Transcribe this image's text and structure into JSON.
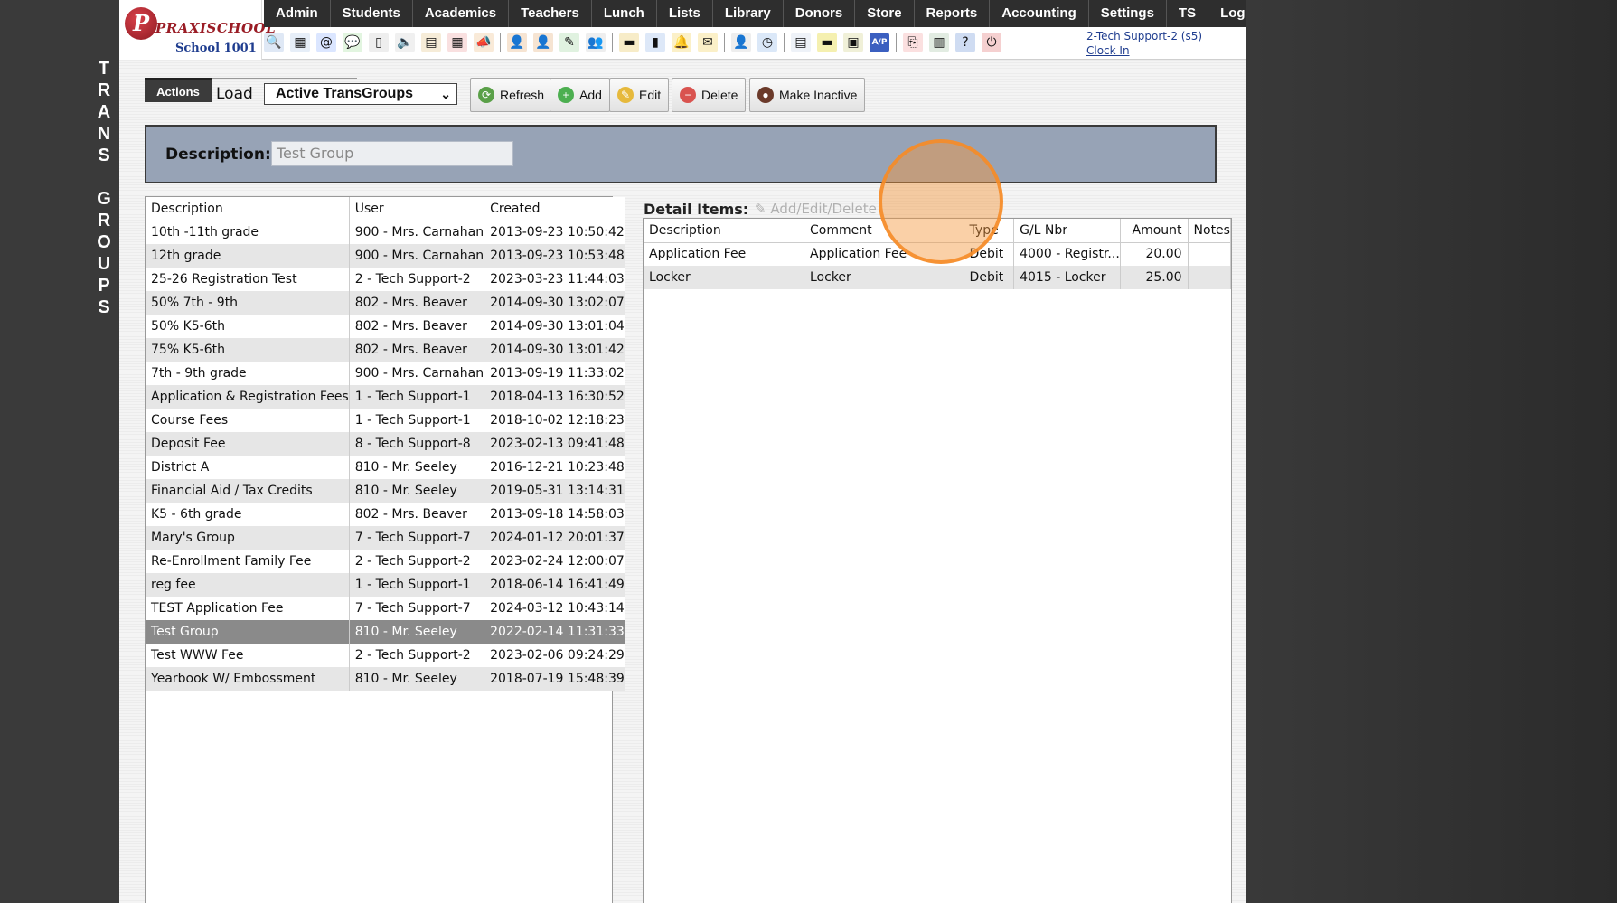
{
  "vertical_title": [
    "T",
    "R",
    "A",
    "N",
    "S",
    "",
    "G",
    "R",
    "O",
    "U",
    "P",
    "S"
  ],
  "logo": {
    "badge": "P",
    "brand": "PRAXISCHOOL",
    "school": "School 1001"
  },
  "menu": [
    "Admin",
    "Students",
    "Academics",
    "Teachers",
    "Lunch",
    "Lists",
    "Library",
    "Donors",
    "Store",
    "Reports",
    "Accounting",
    "Settings",
    "TS",
    "Logout"
  ],
  "toolbar_icons": [
    {
      "name": "search-icon",
      "glyph": "🔍",
      "color": "#dfe8f5"
    },
    {
      "name": "grid-icon",
      "glyph": "▦",
      "color": "#e6eef8"
    },
    {
      "name": "email-icon",
      "glyph": "@",
      "color": "#dbe6ff"
    },
    {
      "name": "chat-icon",
      "glyph": "💬",
      "color": "#e2f5e0"
    },
    {
      "name": "phone-icon",
      "glyph": "▯",
      "color": "#eeeeee"
    },
    {
      "name": "speaker-icon",
      "glyph": "🔈",
      "color": "#f0f0f0"
    },
    {
      "name": "report-icon",
      "glyph": "▤",
      "color": "#f6ecd8"
    },
    {
      "name": "calendar-icon",
      "glyph": "▦",
      "color": "#f9e0e0"
    },
    {
      "name": "megaphone-icon",
      "glyph": "📣",
      "color": "#f9ead8"
    },
    {
      "name": "user-icon",
      "glyph": "👤",
      "color": "#f6e4d2"
    },
    {
      "name": "teacher-icon",
      "glyph": "👤",
      "color": "#f6e4d2"
    },
    {
      "name": "eraser-icon",
      "glyph": "✎",
      "color": "#e0f2e0"
    },
    {
      "name": "group-icon",
      "glyph": "👥",
      "color": "#eeeeee"
    },
    {
      "name": "card-icon",
      "glyph": "▬",
      "color": "#f7ecc8"
    },
    {
      "name": "book-icon",
      "glyph": "▮",
      "color": "#dde8f8"
    },
    {
      "name": "bell-icon",
      "glyph": "🔔",
      "color": "#fbf0c8"
    },
    {
      "name": "mail-out-icon",
      "glyph": "✉",
      "color": "#fbf0c8"
    },
    {
      "name": "staff-icon",
      "glyph": "👤",
      "color": "#eeeeee"
    },
    {
      "name": "clock-icon",
      "glyph": "◷",
      "color": "#dbe8f8"
    },
    {
      "name": "document-icon",
      "glyph": "▤",
      "color": "#eef2f8"
    },
    {
      "name": "payment-card-icon",
      "glyph": "▬",
      "color": "#f5f0b0"
    },
    {
      "name": "register-icon",
      "glyph": "▣",
      "color": "#f0f0d8"
    },
    {
      "name": "ap-icon",
      "glyph": "A/P",
      "color": "#3b5fc0"
    },
    {
      "name": "pdf-icon",
      "glyph": "⎘",
      "color": "#fbe0e0"
    },
    {
      "name": "money-icon",
      "glyph": "▥",
      "color": "#e2ece2"
    },
    {
      "name": "help-icon",
      "glyph": "?",
      "color": "#cfdcf2"
    },
    {
      "name": "power-icon",
      "glyph": "⏻",
      "color": "#f5d0d0"
    }
  ],
  "user": {
    "name": "2-Tech Support-2 (s5)",
    "clock_in": "Clock In"
  },
  "actions": {
    "tab": "Actions",
    "load_label": "Load",
    "load_value": "Active TransGroups",
    "buttons": {
      "refresh": "Refresh",
      "add": "Add",
      "edit": "Edit",
      "delete": "Delete",
      "make_inactive": "Make Inactive"
    }
  },
  "description": {
    "label": "Description:",
    "value": "Test Group"
  },
  "list": {
    "columns": [
      "Description",
      "User",
      "Created"
    ],
    "rows": [
      [
        "10th -11th grade",
        "900 - Mrs. Carnahan",
        "2013-09-23 10:50:42"
      ],
      [
        "12th grade",
        "900 - Mrs. Carnahan",
        "2013-09-23 10:53:48"
      ],
      [
        "25-26 Registration Test",
        "2 - Tech Support-2",
        "2023-03-23 11:44:03"
      ],
      [
        "50% 7th - 9th",
        "802 - Mrs. Beaver",
        "2014-09-30 13:02:07"
      ],
      [
        "50% K5-6th",
        "802 - Mrs. Beaver",
        "2014-09-30 13:01:04"
      ],
      [
        "75% K5-6th",
        "802 - Mrs. Beaver",
        "2014-09-30 13:01:42"
      ],
      [
        "7th - 9th grade",
        "900 - Mrs. Carnahan",
        "2013-09-19 11:33:02"
      ],
      [
        "Application & Registration Fees",
        "1 - Tech Support-1",
        "2018-04-13 16:30:52"
      ],
      [
        "Course Fees",
        "1 - Tech Support-1",
        "2018-10-02 12:18:23"
      ],
      [
        "Deposit Fee",
        "8 - Tech Support-8",
        "2023-02-13 09:41:48"
      ],
      [
        "District A",
        "810 - Mr. Seeley",
        "2016-12-21 10:23:48"
      ],
      [
        "Financial Aid / Tax Credits",
        "810 - Mr. Seeley",
        "2019-05-31 13:14:31"
      ],
      [
        "K5 - 6th grade",
        "802 - Mrs. Beaver",
        "2013-09-18 14:58:03"
      ],
      [
        "Mary's Group",
        "7 - Tech Support-7",
        "2024-01-12 20:01:37"
      ],
      [
        "Re-Enrollment Family Fee",
        "2 - Tech Support-2",
        "2023-02-24 12:00:07"
      ],
      [
        "reg fee",
        "1 - Tech Support-1",
        "2018-06-14 16:41:49"
      ],
      [
        "TEST Application Fee",
        "7 - Tech Support-7",
        "2024-03-12 10:43:14"
      ],
      [
        "Test Group",
        "810 - Mr. Seeley",
        "2022-02-14 11:31:33"
      ],
      [
        "Test WWW Fee",
        "2 - Tech Support-2",
        "2023-02-06 09:24:29"
      ],
      [
        "Yearbook W/ Embossment",
        "810 - Mr. Seeley",
        "2018-07-19 15:48:39"
      ]
    ],
    "selected_index": 17
  },
  "detail": {
    "title": "Detail Items:",
    "link": "Add/Edit/Delete",
    "columns": [
      "Description",
      "Comment",
      "Type",
      "G/L Nbr",
      "Amount",
      "Notes"
    ],
    "rows": [
      [
        "Application Fee",
        "Application Fee",
        "Debit",
        "4000 - Registr...",
        "20.00",
        ""
      ],
      [
        "Locker",
        "Locker",
        "Debit",
        "4015 - Locker",
        "25.00",
        ""
      ]
    ]
  }
}
